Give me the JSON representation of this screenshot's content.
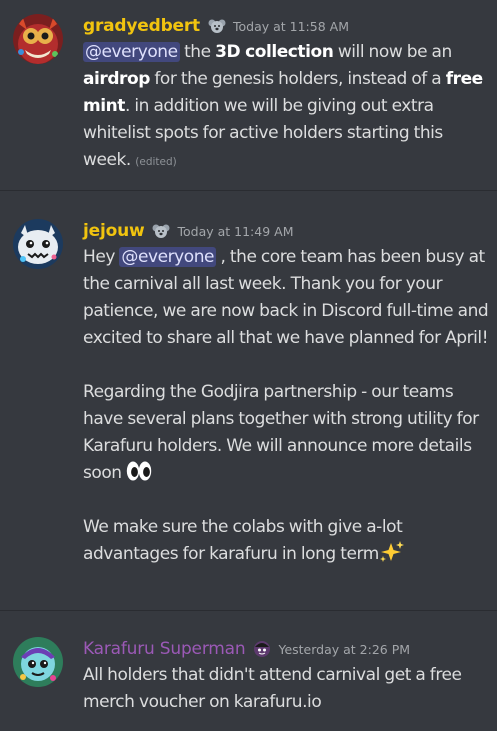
{
  "messages": [
    {
      "username": "gradyedbert",
      "username_color": "#f1c40f",
      "timestamp": "Today at 11:58 AM",
      "mention": "@everyone",
      "t1": " the ",
      "b1": "3D collection",
      "t2": " will now be an ",
      "b2": "airdrop",
      "t3": " for the genesis holders, instead of a ",
      "b3": "free mint",
      "t4": ". in addition we will be giving out extra whitelist spots for active holders starting this week. ",
      "edited": "(edited)"
    },
    {
      "username": "jejouw",
      "username_color": "#f1c40f",
      "timestamp": "Today at 11:49 AM",
      "p1_pre": "Hey ",
      "mention": "@everyone",
      "p1_post": " , the core team has been busy at the carnival all last week. Thank you for your patience, we are now back in Discord full-time and excited to share all that we have planned for April!",
      "p2": "Regarding the Godjira partnership - our teams have several plans together with strong utility for Karafuru holders. We will announce more details soon ",
      "p2_emoji": "eyes-emoji",
      "p3": "We make sure the colabs with give a-lot advantages for karafuru in long term",
      "p3_emoji": "sparkles-emoji"
    },
    {
      "username": "Karafuru Superman",
      "username_color": "#9b59b6",
      "timestamp": "Yesterday at 2:26 PM",
      "text": "All holders that didn't attend carnival get a free merch voucher on karafuru.io"
    }
  ],
  "colors": {
    "background": "#36393f",
    "text": "#dcddde",
    "mention_bg": "#4e5398",
    "timestamp": "#a3a6aa"
  }
}
